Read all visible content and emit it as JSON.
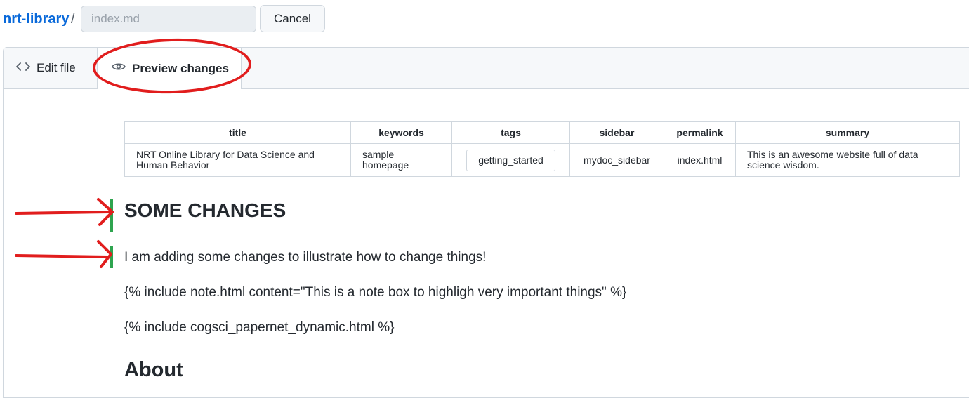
{
  "header": {
    "repo": "nrt-library",
    "separator": "/",
    "filename_placeholder": "index.md",
    "cancel_label": "Cancel"
  },
  "tabs": {
    "edit_label": "Edit file",
    "preview_label": "Preview changes"
  },
  "front_matter_table": {
    "headers": [
      "title",
      "keywords",
      "tags",
      "sidebar",
      "permalink",
      "summary"
    ],
    "row": {
      "title": "NRT Online Library for Data Science and Human Behavior",
      "keywords": "sample homepage",
      "tags": "getting_started",
      "sidebar": "mydoc_sidebar",
      "permalink": "index.html",
      "summary": "This is an awesome website full of data science wisdom."
    }
  },
  "content": {
    "heading": "SOME CHANGES",
    "changed_paragraph": "I am adding some changes to illustrate how to change things!",
    "include_note": "{% include note.html content=\"This is a note box to highligh very important things\" %}",
    "include_cogsci": "{% include cogsci_papernet_dynamic.html %}",
    "about_heading": "About"
  },
  "colors": {
    "link": "#0969da",
    "diff_added_bar": "#2ea44f",
    "annotation_red": "#e11d1d"
  },
  "icons": {
    "edit_tab": "code-icon",
    "preview_tab": "eye-icon"
  }
}
